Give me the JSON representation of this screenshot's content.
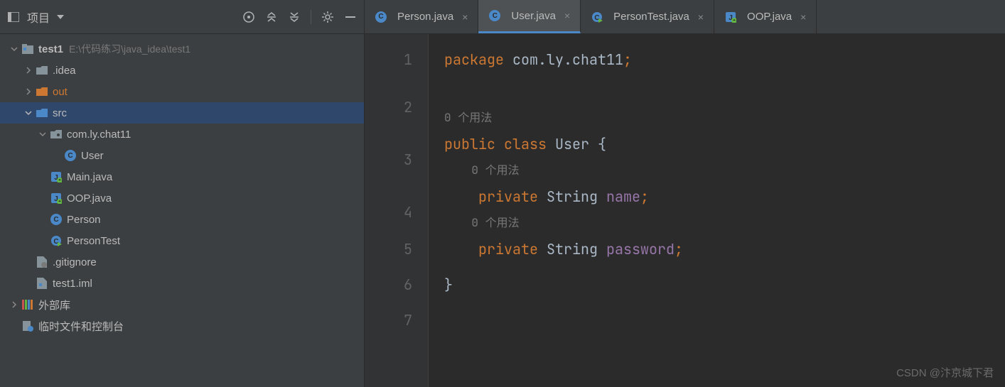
{
  "sidebar": {
    "title": "项目",
    "project": {
      "name": "test1",
      "path": "E:\\代码练习\\java_idea\\test1"
    },
    "nodes": {
      "idea": ".idea",
      "out": "out",
      "src": "src",
      "pkg": "com.ly.chat11",
      "user": "User",
      "main": "Main.java",
      "oop": "OOP.java",
      "person": "Person",
      "personTest": "PersonTest",
      "gitignore": ".gitignore",
      "iml": "test1.iml",
      "extLib": "外部库",
      "scratch": "临时文件和控制台"
    }
  },
  "tabs": [
    {
      "label": "Person.java",
      "type": "class"
    },
    {
      "label": "User.java",
      "type": "class",
      "active": true
    },
    {
      "label": "PersonTest.java",
      "type": "test"
    },
    {
      "label": "OOP.java",
      "type": "jclass"
    }
  ],
  "gutter": [
    "1",
    "2",
    "3",
    "4",
    "5",
    "6",
    "7"
  ],
  "hints": {
    "usages0": "0 个用法"
  },
  "code": {
    "kw_package": "package",
    "pkg_name": " com.ly.chat11",
    "semi": ";",
    "kw_public": "public",
    "kw_class": " class",
    "cls_name": " User ",
    "brace_open": "{",
    "kw_private": "private",
    "type_string": " String ",
    "field_name": "name",
    "field_password": "password",
    "brace_close": "}",
    "indent": "    ",
    "sp": " "
  },
  "watermark": "CSDN @汴京城下君"
}
